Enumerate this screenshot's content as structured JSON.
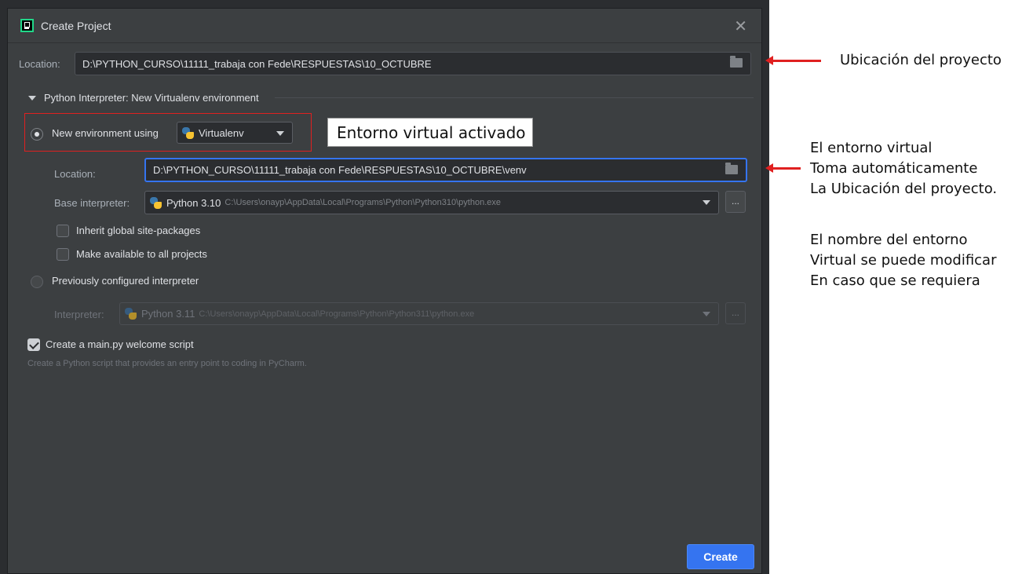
{
  "dialog": {
    "title": "Create Project",
    "location_label": "Location:",
    "location_value": "D:\\PYTHON_CURSO\\11111_trabaja con Fede\\RESPUESTAS\\10_OCTUBRE",
    "interpreter_section": "Python Interpreter: New Virtualenv environment",
    "new_env_label": "New environment using",
    "new_env_tool": "Virtualenv",
    "venv_location_label": "Location:",
    "venv_location_value": "D:\\PYTHON_CURSO\\11111_trabaja con Fede\\RESPUESTAS\\10_OCTUBRE\\venv",
    "base_interpreter_label": "Base interpreter:",
    "base_interpreter_version": "Python 3.10",
    "base_interpreter_path": "C:\\Users\\onayp\\AppData\\Local\\Programs\\Python\\Python310\\python.exe",
    "inherit_label": "Inherit global site-packages",
    "make_available_label": "Make available to all projects",
    "prev_configured_label": "Previously configured interpreter",
    "interpreter_label": "Interpreter:",
    "interpreter_version": "Python 3.11",
    "interpreter_path": "C:\\Users\\onayp\\AppData\\Local\\Programs\\Python\\Python311\\python.exe",
    "welcome_script_label": "Create a main.py welcome script",
    "welcome_script_hint": "Create a Python script that provides an entry point to coding in PyCharm.",
    "browse_label": "...",
    "create_label": "Create",
    "close_glyph": "✕"
  },
  "annotations": {
    "callout_env": "Entorno virtual activado",
    "note_location": "Ubicación del proyecto",
    "note_venv": [
      "El entorno virtual",
      "Toma automáticamente",
      "La Ubicación del proyecto."
    ],
    "note_name": [
      "El nombre del entorno",
      "Virtual se puede modificar",
      "En caso que se requiera"
    ]
  },
  "state": {
    "new_env_selected": true,
    "inherit_checked": false,
    "make_available_checked": false,
    "welcome_script_checked": true
  },
  "colors": {
    "dialog_bg": "#3c3f41",
    "accent": "#3574f0",
    "annotation_red": "#e02020"
  }
}
